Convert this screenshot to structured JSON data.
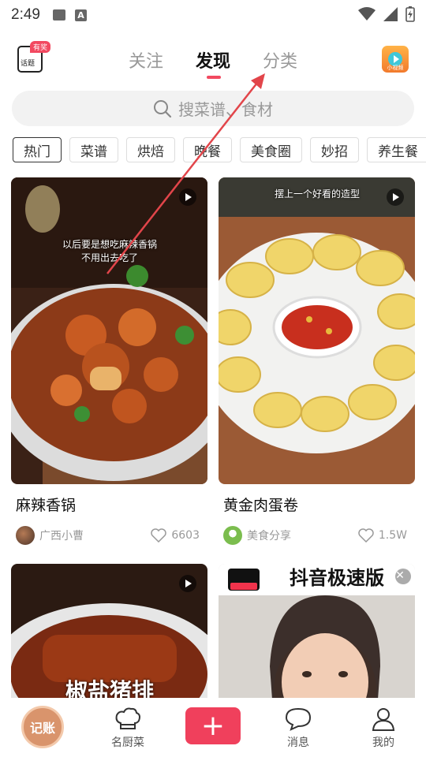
{
  "status_bar": {
    "time": "2:49"
  },
  "header": {
    "checkin": {
      "label": "话题",
      "badge": "有奖"
    },
    "tabs": [
      {
        "label": "关注",
        "active": false
      },
      {
        "label": "发现",
        "active": true
      },
      {
        "label": "分类",
        "active": false
      }
    ],
    "video_button_label": "小视频"
  },
  "search": {
    "placeholder": "搜菜谱、食材"
  },
  "chips": [
    "热门",
    "菜谱",
    "烘焙",
    "晚餐",
    "美食圈",
    "妙招",
    "养生餐"
  ],
  "feed": [
    {
      "title": "麻辣香锅",
      "author": "广西小曹",
      "likes": "6603",
      "caption": "以后要是想吃麻辣香锅\n不用出去吃了"
    },
    {
      "title": "黄金肉蛋卷",
      "author": "美食分享",
      "likes": "1.5W",
      "caption": "摆上一个好看的造型"
    },
    {
      "title": "",
      "author": "",
      "likes": "",
      "caption": "椒盐猪排"
    },
    {
      "title": "",
      "author": "",
      "likes": "",
      "caption": "抖音极速版"
    }
  ],
  "bottom_nav": {
    "ledger": "记账",
    "items": [
      "名厨菜",
      "消息",
      "我的"
    ]
  },
  "colors": {
    "accent": "#f0405c",
    "ledger": "#d9946c",
    "annotation_arrow": "#e2454a"
  }
}
